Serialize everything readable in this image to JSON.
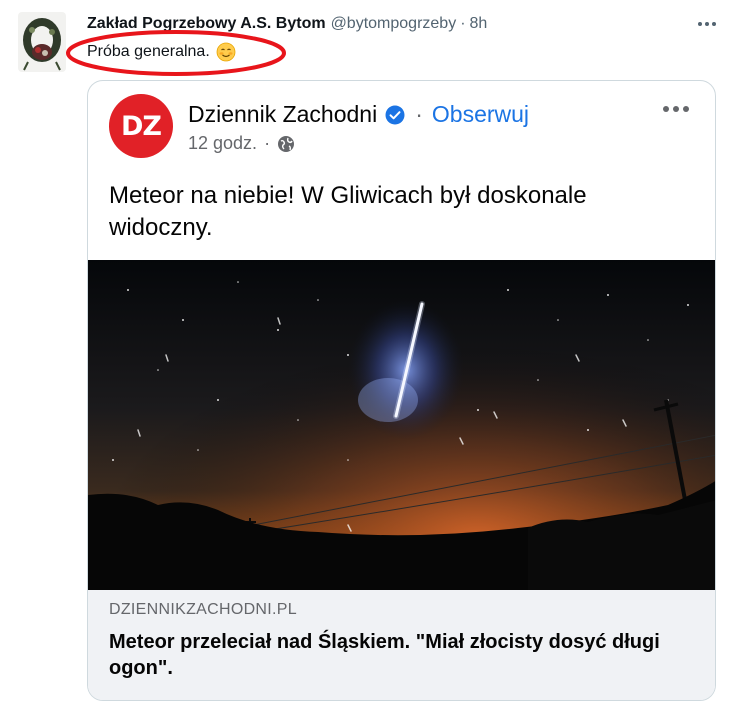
{
  "tweet": {
    "author_name": "Zakład Pogrzebowy A.S. Bytom",
    "handle": "@bytompogrzeby",
    "separator": "·",
    "time": "8h",
    "text": "Próba generalna.",
    "emoji_icon": "smiling-face-emoji",
    "highlight_color": "#e8151b"
  },
  "embed": {
    "avatar_text": "DZ",
    "avatar_color": "#e12127",
    "page_name": "Dziennik Zachodni",
    "separator": "·",
    "follow_label": "Obserwuj",
    "post_time": "12 godz.",
    "sub_separator": "·",
    "post_text": "Meteor na niebie! W Gliwicach był doskonale widoczny.",
    "link_domain": "DZIENNIKZACHODNI.PL",
    "link_title": "Meteor przeleciał nad Śląskiem. \"Miał złocisty dosyć długi ogon\".",
    "accent_color": "#1b74e4"
  }
}
